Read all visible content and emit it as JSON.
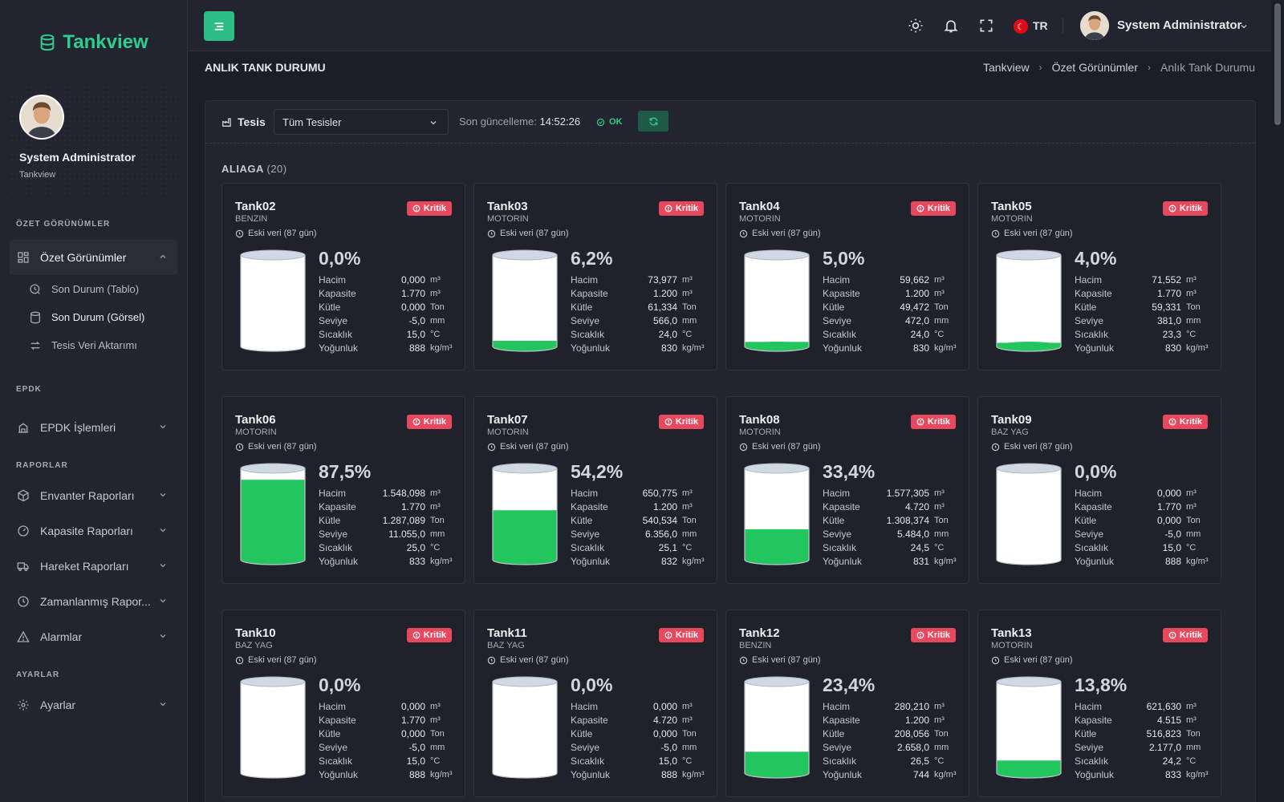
{
  "brand": {
    "name": "Tankview"
  },
  "sidebar": {
    "profile": {
      "name": "System Administrator",
      "subtitle": "Tankview"
    },
    "sections": {
      "ozet": "ÖZET GÖRÜNÜMLER",
      "epdk": "EPDK",
      "raporlar": "RAPORLAR",
      "ayarlar": "AYARLAR"
    },
    "items": {
      "ozet_gorunumler": "Özet Görünümler",
      "son_durum_tablo": "Son Durum (Tablo)",
      "son_durum_gorsel": "Son Durum (Görsel)",
      "tesis_veri": "Tesis Veri Aktarımı",
      "epdk_islemleri": "EPDK İşlemleri",
      "envanter": "Envanter Raporları",
      "kapasite": "Kapasite Raporları",
      "hareket": "Hareket Raporları",
      "zamanlanmis": "Zamanlanmış Rapor...",
      "alarmlar": "Alarmlar",
      "ayarlar": "Ayarlar"
    }
  },
  "topbar": {
    "language": "TR",
    "user_name": "System Administrator"
  },
  "page": {
    "title": "ANLIK TANK DURUMU",
    "breadcrumb": [
      "Tankview",
      "Özet Görünümler",
      "Anlık Tank Durumu"
    ]
  },
  "filter": {
    "label": "Tesis",
    "selected": "Tüm Tesisler",
    "last_update_label": "Son güncelleme:",
    "last_update_time": "14:52:26",
    "status": "OK"
  },
  "group": {
    "name": "ALIAGA",
    "count": "(20)"
  },
  "labels": {
    "hacim": "Hacim",
    "kapasite": "Kapasite",
    "kutle": "Kütle",
    "seviye": "Seviye",
    "sicaklik": "Sıcaklık",
    "yogunluk": "Yoğunluk",
    "badge": "Kritik",
    "old_data": "Eski veri (87 gün)",
    "u_m3": "m³",
    "u_ton": "Ton",
    "u_mm": "mm",
    "u_c": "°C",
    "u_kgm3": "kg/m³"
  },
  "colors": {
    "accent": "#2ebd84",
    "critical": "#e8485d",
    "fill": "#22c55e"
  },
  "tanks": [
    {
      "name": "Tank02",
      "product": "BENZIN",
      "pct": "0,0%",
      "fill": 0.0,
      "hacim": "0,000",
      "kapasite": "1.770",
      "kutle": "0,000",
      "seviye": "-5,0",
      "sicaklik": "15,0",
      "yogunluk": "888"
    },
    {
      "name": "Tank03",
      "product": "MOTORIN",
      "pct": "6,2%",
      "fill": 0.062,
      "hacim": "73,977",
      "kapasite": "1.200",
      "kutle": "61,334",
      "seviye": "566,0",
      "sicaklik": "24,0",
      "yogunluk": "830"
    },
    {
      "name": "Tank04",
      "product": "MOTORIN",
      "pct": "5,0%",
      "fill": 0.05,
      "hacim": "59,662",
      "kapasite": "1.200",
      "kutle": "49,472",
      "seviye": "472,0",
      "sicaklik": "24,0",
      "yogunluk": "830"
    },
    {
      "name": "Tank05",
      "product": "MOTORIN",
      "pct": "4,0%",
      "fill": 0.04,
      "hacim": "71,552",
      "kapasite": "1.770",
      "kutle": "59,331",
      "seviye": "381,0",
      "sicaklik": "23,3",
      "yogunluk": "830"
    },
    {
      "name": "Tank06",
      "product": "MOTORIN",
      "pct": "87,5%",
      "fill": 0.875,
      "hacim": "1.548,098",
      "kapasite": "1.770",
      "kutle": "1.287,089",
      "seviye": "11.055,0",
      "sicaklik": "25,0",
      "yogunluk": "833"
    },
    {
      "name": "Tank07",
      "product": "MOTORIN",
      "pct": "54,2%",
      "fill": 0.542,
      "hacim": "650,775",
      "kapasite": "1.200",
      "kutle": "540,534",
      "seviye": "6.356,0",
      "sicaklik": "25,1",
      "yogunluk": "832"
    },
    {
      "name": "Tank08",
      "product": "MOTORIN",
      "pct": "33,4%",
      "fill": 0.334,
      "hacim": "1.577,305",
      "kapasite": "4.720",
      "kutle": "1.308,374",
      "seviye": "5.484,0",
      "sicaklik": "24,5",
      "yogunluk": "831"
    },
    {
      "name": "Tank09",
      "product": "BAZ YAG",
      "pct": "0,0%",
      "fill": 0.0,
      "hacim": "0,000",
      "kapasite": "1.770",
      "kutle": "0,000",
      "seviye": "-5,0",
      "sicaklik": "15,0",
      "yogunluk": "888"
    },
    {
      "name": "Tank10",
      "product": "BAZ YAG",
      "pct": "0,0%",
      "fill": 0.0,
      "hacim": "0,000",
      "kapasite": "1.770",
      "kutle": "0,000",
      "seviye": "-5,0",
      "sicaklik": "15,0",
      "yogunluk": "888"
    },
    {
      "name": "Tank11",
      "product": "BAZ YAG",
      "pct": "0,0%",
      "fill": 0.0,
      "hacim": "0,000",
      "kapasite": "4.720",
      "kutle": "0,000",
      "seviye": "-5,0",
      "sicaklik": "15,0",
      "yogunluk": "888"
    },
    {
      "name": "Tank12",
      "product": "BENZIN",
      "pct": "23,4%",
      "fill": 0.234,
      "hacim": "280,210",
      "kapasite": "1.200",
      "kutle": "208,056",
      "seviye": "2.658,0",
      "sicaklik": "26,5",
      "yogunluk": "744"
    },
    {
      "name": "Tank13",
      "product": "MOTORIN",
      "pct": "13,8%",
      "fill": 0.138,
      "hacim": "621,630",
      "kapasite": "4.515",
      "kutle": "516,823",
      "seviye": "2.177,0",
      "sicaklik": "24,2",
      "yogunluk": "833"
    }
  ]
}
